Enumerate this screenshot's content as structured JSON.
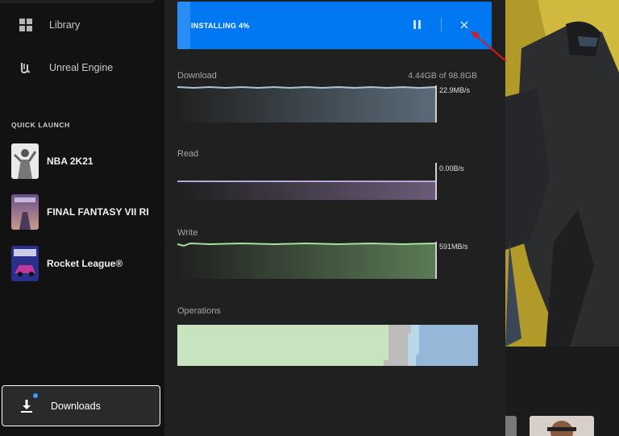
{
  "sidebar": {
    "nav": [
      {
        "label": "Library",
        "icon": "grid-icon"
      },
      {
        "label": "Unreal Engine",
        "icon": "unreal-engine-logo-icon"
      }
    ],
    "quick_launch_title": "QUICK LAUNCH",
    "quick_launch": [
      {
        "label": "NBA 2K21"
      },
      {
        "label": "FINAL FANTASY VII REMAKE"
      },
      {
        "label": "Rocket League®"
      }
    ],
    "downloads": {
      "label": "Downloads",
      "icon": "download-arrow-icon",
      "badge_color": "#3b9bff"
    }
  },
  "install": {
    "status": "INSTALLING 4%",
    "progress_percent": 4,
    "accent": "#0078f2"
  },
  "metrics": {
    "download": {
      "label": "Download",
      "size": "4.44GB of 98.8GB",
      "rate": "22.9MB/s"
    },
    "read": {
      "label": "Read",
      "rate": "0.00B/s"
    },
    "write": {
      "label": "Write",
      "rate": "591MB/s"
    },
    "operations": {
      "label": "Operations"
    }
  },
  "colors": {
    "download_line": "#a8c8d8",
    "read_line": "#b7a8d8",
    "write_line": "#a8e0a0",
    "ops_green": "#c8e3c0",
    "ops_gray": "#bcbcbc",
    "ops_blue": "#95b8d8"
  }
}
